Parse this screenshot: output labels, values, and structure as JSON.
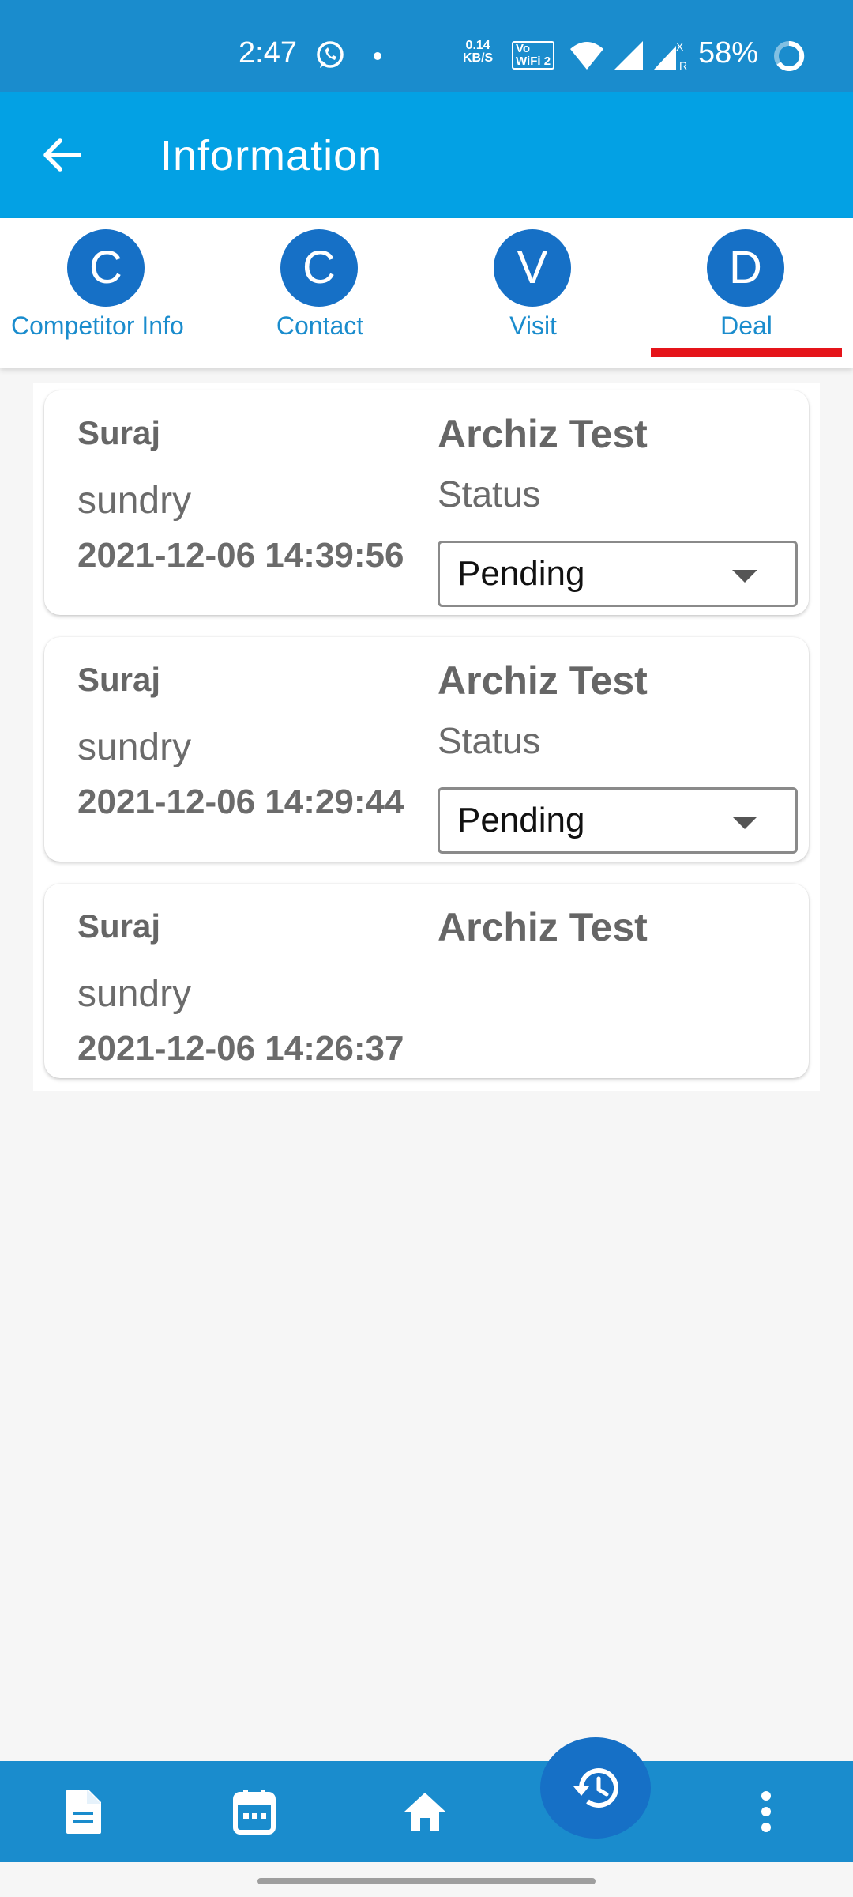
{
  "status_bar": {
    "time": "2:47",
    "net_speed_value": "0.14",
    "net_speed_unit": "KB/S",
    "volte_line1": "Vo",
    "volte_line2": "WiFi 2",
    "battery": "58%",
    "icons": [
      "whatsapp-icon",
      "dot-icon",
      "wifi-icon",
      "signal-icon",
      "signal-roaming-icon",
      "battery-icon"
    ]
  },
  "app_bar": {
    "title": "Information",
    "back_icon": "arrow-left-icon"
  },
  "tabs": [
    {
      "letter": "C",
      "label": "Competitor Info",
      "selected": false
    },
    {
      "letter": "C",
      "label": "Contact",
      "selected": false
    },
    {
      "letter": "V",
      "label": "Visit",
      "selected": false
    },
    {
      "letter": "D",
      "label": "Deal",
      "selected": true
    }
  ],
  "deals": [
    {
      "name": "Suraj",
      "type": "sundry",
      "datetime": "2021-12-06 14:39:56",
      "company": "Archiz Test",
      "status_label": "Status",
      "status_value": "Pending"
    },
    {
      "name": "Suraj",
      "type": "sundry",
      "datetime": "2021-12-06 14:29:44",
      "company": "Archiz Test",
      "status_label": "Status",
      "status_value": "Pending"
    },
    {
      "name": "Suraj",
      "type": "sundry",
      "datetime": "2021-12-06 14:26:37",
      "company": "Archiz Test"
    }
  ],
  "bottom_nav": {
    "items": [
      "document-icon",
      "calendar-icon",
      "home-icon",
      "history-icon",
      "more-vertical-icon"
    ]
  },
  "colors": {
    "status_bar": "#1a8ccd",
    "app_bar": "#03a1e4",
    "tab_circle": "#1670c6",
    "tab_label": "#1a8ccd",
    "tab_indicator": "#e5141a",
    "bottom_nav": "#1a8ccd"
  }
}
